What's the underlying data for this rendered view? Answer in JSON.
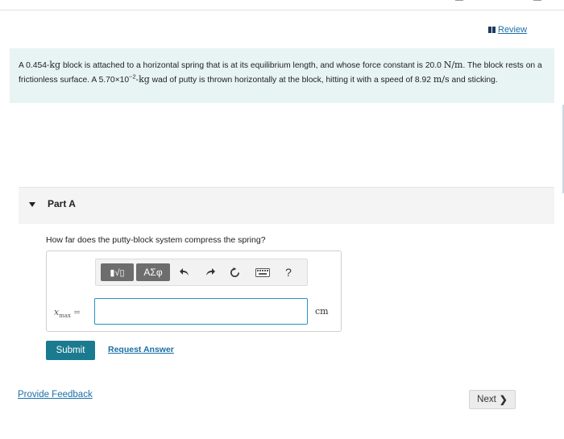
{
  "header": {
    "review_label": "Review"
  },
  "problem": {
    "p1": "A 0.454-",
    "kg1": "kg",
    "p2": " block is attached to a horizontal spring that is at its equilibrium length, and whose force constant is 20.0 ",
    "nm": "N/m",
    "p3": ". The block rests on a frictionless surface. A 5.70×10",
    "exp": "−2",
    "p4": "-",
    "kg2": "kg",
    "p5": " wad of putty is thrown horizontally at the block, hitting it with a speed of 8.92 ",
    "ms": "m/s",
    "p6": " and sticking."
  },
  "part": {
    "title": "Part A",
    "question": "How far does the putty-block system compress the spring?"
  },
  "toolbar": {
    "templates_label": "▮√▯",
    "greek_label": "ΑΣφ",
    "help_label": "?"
  },
  "answer": {
    "var_name": "x",
    "var_sub": "max",
    "equals": "=",
    "value": "",
    "unit": "cm"
  },
  "actions": {
    "submit_label": "Submit",
    "request_label": "Request Answer",
    "feedback_label": "Provide Feedback",
    "next_label": "Next",
    "next_chevron": "❯"
  },
  "colors": {
    "accent": "#1a7a8f",
    "link": "#1a6fa8",
    "problem_bg": "#e8f4f4"
  }
}
